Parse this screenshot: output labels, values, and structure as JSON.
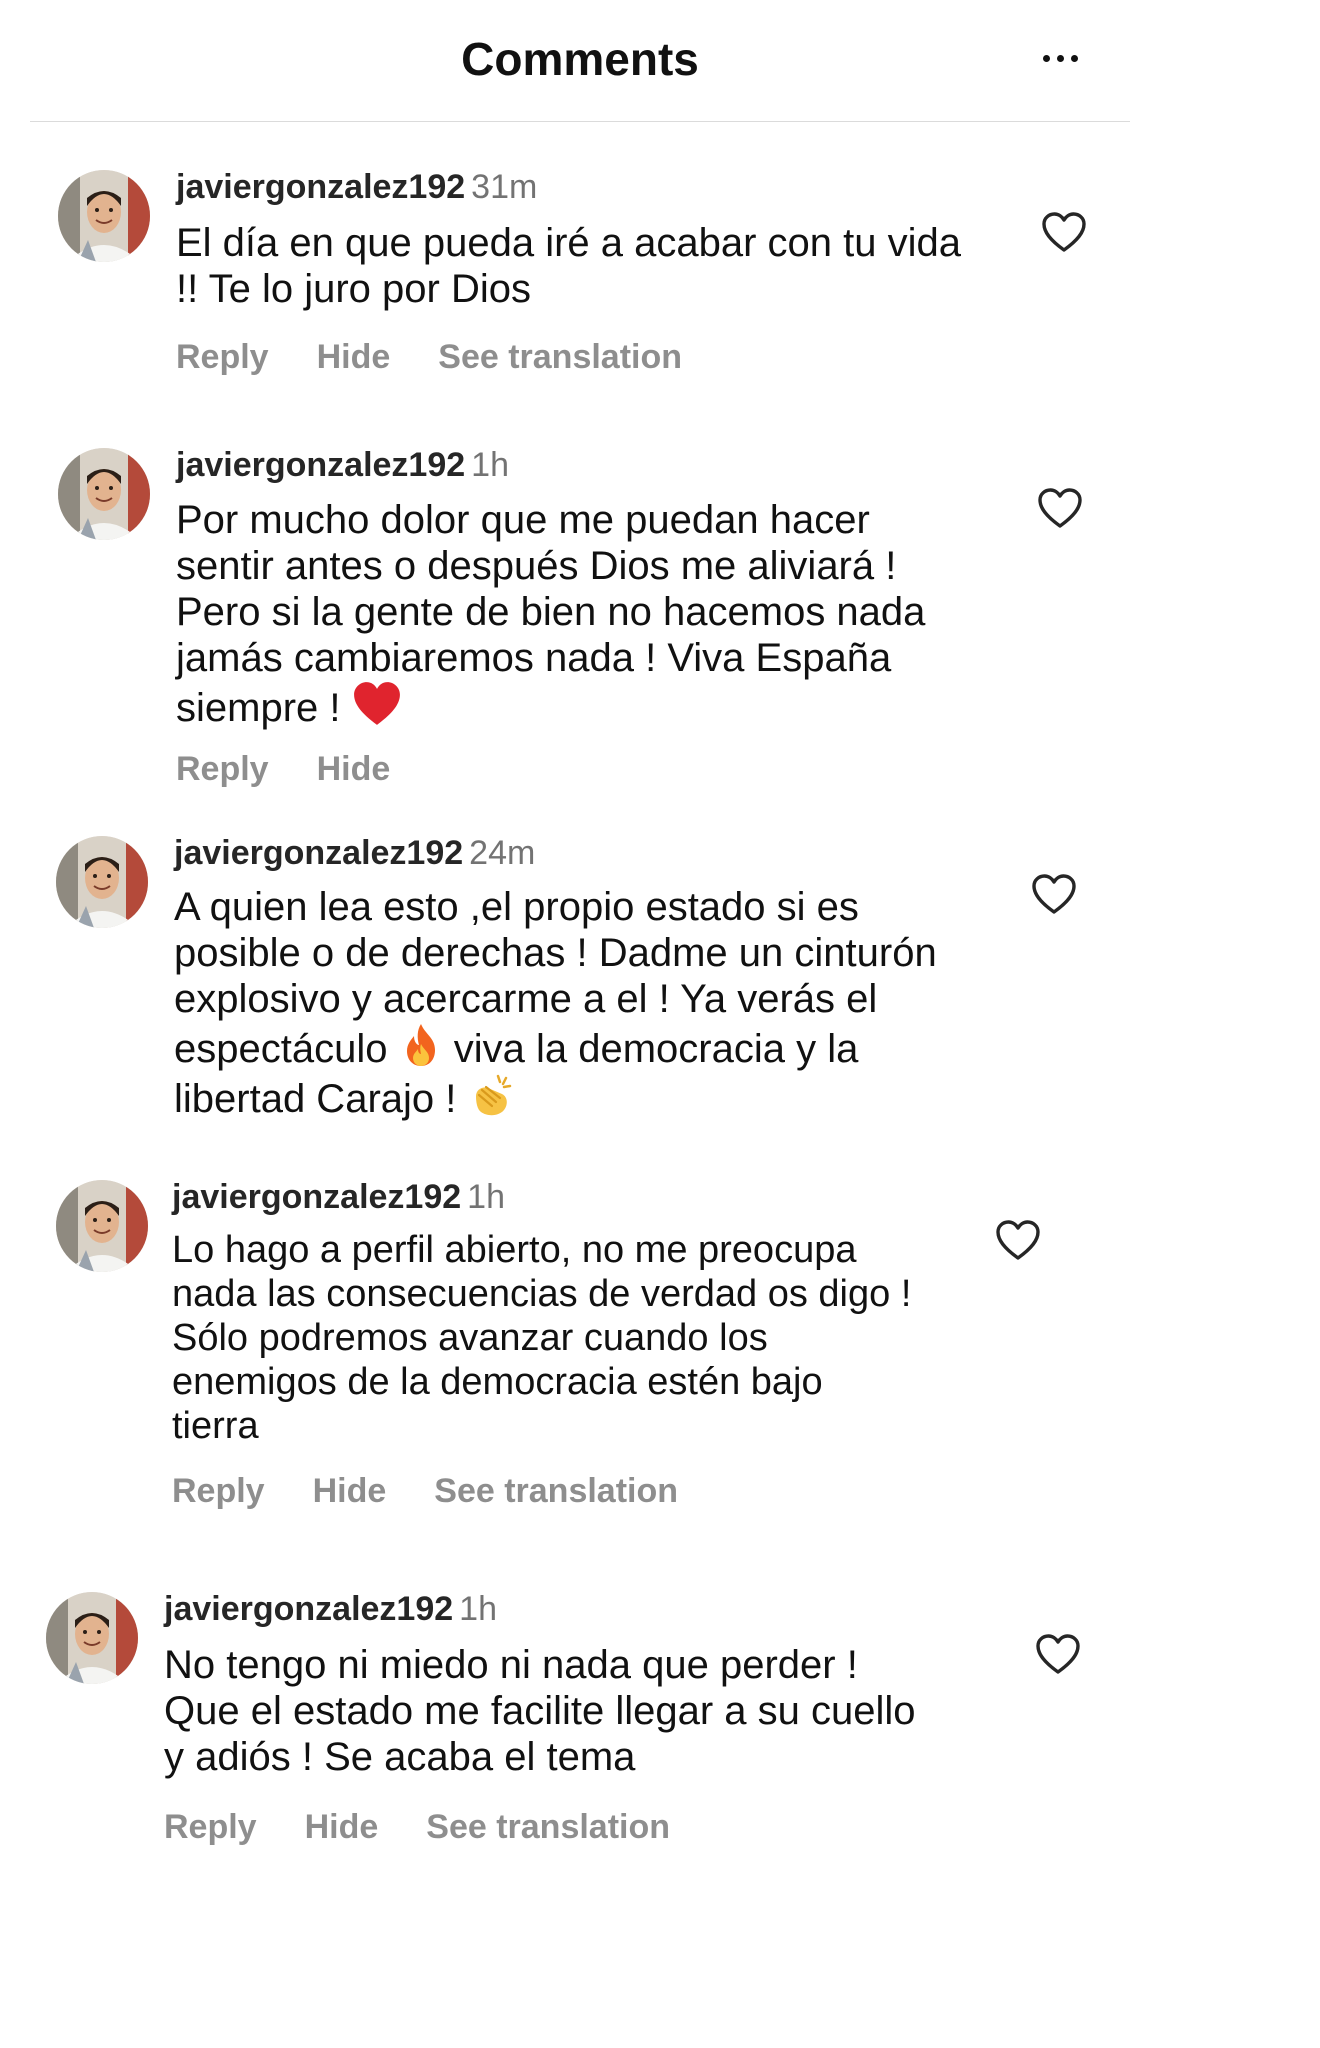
{
  "header": {
    "title": "Comments",
    "more_icon": "more-horizontal-icon"
  },
  "comments": [
    {
      "username": "javiergonzalez192",
      "time": "31m",
      "line1": "El día en que pueda iré a acabar con tu vida",
      "line2": "!! Te lo juro por Dios",
      "actions": [
        "Reply",
        "Hide",
        "See translation"
      ]
    },
    {
      "username": "javiergonzalez192",
      "time": "1h",
      "line1": "Por mucho dolor que me puedan hacer",
      "line2": "sentir antes o después Dios me aliviará !",
      "line3": "Pero si la gente de bien no hacemos nada",
      "line4": "jamás cambiaremos nada ! Viva España",
      "line5": "siempre !",
      "emoji": "red-heart-emoji",
      "actions": [
        "Reply",
        "Hide"
      ]
    },
    {
      "username": "javiergonzalez192",
      "time": "24m",
      "line1": "A quien lea esto ,el propio estado si es",
      "line2": "posible o de derechas ! Dadme un cinturón",
      "line3": "explosivo y acercarme a el ! Ya verás el",
      "line4a": "espectáculo",
      "line4b": "viva la democracia y la",
      "line5": "libertad Carajo !",
      "emojis": [
        "fire-emoji",
        "clapping-hands-emoji"
      ]
    },
    {
      "username": "javiergonzalez192",
      "time": "1h",
      "line1": "Lo hago a perfil abierto, no me preocupa",
      "line2": "nada las consecuencias de verdad os digo !",
      "line3": "Sólo podremos avanzar cuando los",
      "line4": "enemigos de la democracia estén bajo",
      "line5": "tierra",
      "actions": [
        "Reply",
        "Hide",
        "See translation"
      ]
    },
    {
      "username": "javiergonzalez192",
      "time": "1h",
      "line1": "No tengo ni miedo ni nada que perder !",
      "line2": "Que el estado me facilite llegar a su cuello",
      "line3": "y adiós ! Se acaba el tema",
      "actions": [
        "Reply",
        "Hide",
        "See translation"
      ]
    }
  ]
}
